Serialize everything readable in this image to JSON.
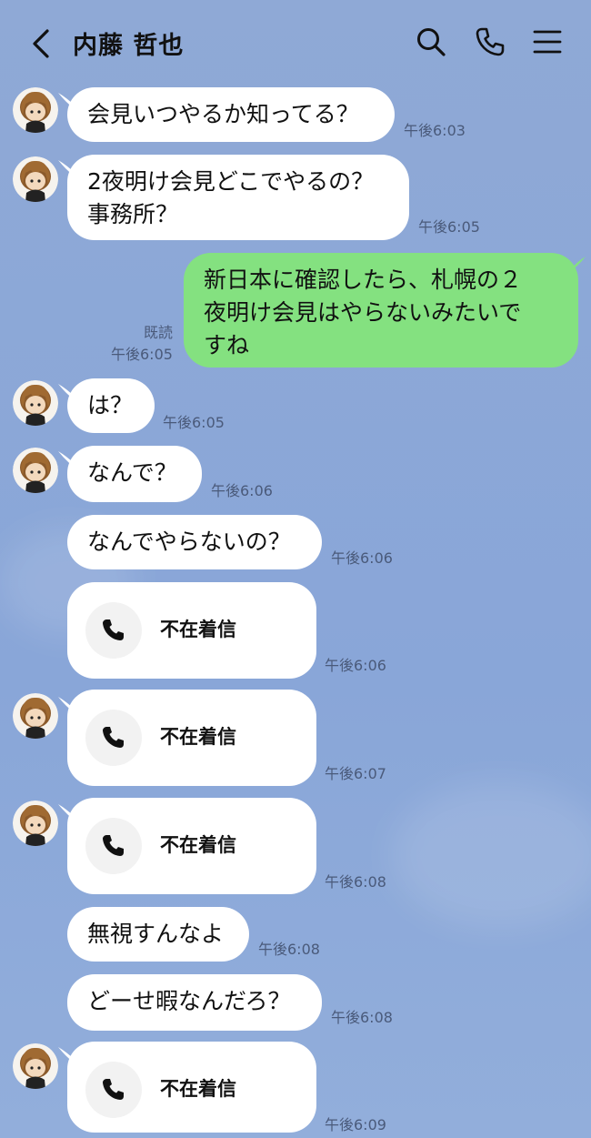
{
  "header": {
    "title": "内藤 哲也"
  },
  "messages": [
    {
      "side": "in",
      "text": "会見いつやるか知ってる？",
      "time": "午後6:03"
    },
    {
      "side": "in",
      "text": "2夜明け会見どこでやるの？\n事務所？",
      "time": "午後6:05"
    },
    {
      "side": "out",
      "text": "新日本に確認したら、札幌の２\n夜明け会見はやらないみたいで\nすね",
      "read": "既読",
      "time": "午後6:05"
    },
    {
      "side": "in",
      "text": "は？",
      "time": "午後6:05"
    },
    {
      "side": "in",
      "text": "なんで？",
      "time": "午後6:06"
    },
    {
      "side": "in",
      "text": "なんでやらないの？",
      "time": "午後6:06"
    },
    {
      "side": "in",
      "type": "call",
      "text": "不在着信",
      "time": "午後6:06"
    },
    {
      "side": "in",
      "type": "call",
      "text": "不在着信",
      "time": "午後6:07"
    },
    {
      "side": "in",
      "type": "call",
      "text": "不在着信",
      "time": "午後6:08"
    },
    {
      "side": "in",
      "text": "無視すんなよ",
      "time": "午後6:08"
    },
    {
      "side": "in",
      "text": "どーせ暇なんだろ？",
      "time": "午後6:08"
    },
    {
      "side": "in",
      "type": "call",
      "text": "不在着信",
      "time": "午後6:09"
    }
  ],
  "icons": {
    "back": "chevron-left-icon",
    "search": "search-icon",
    "call": "phone-icon",
    "menu": "menu-icon",
    "missed_call": "phone-icon"
  },
  "colors": {
    "background": "#8aa7d8",
    "incoming_bubble": "#ffffff",
    "outgoing_bubble": "#84e180"
  }
}
